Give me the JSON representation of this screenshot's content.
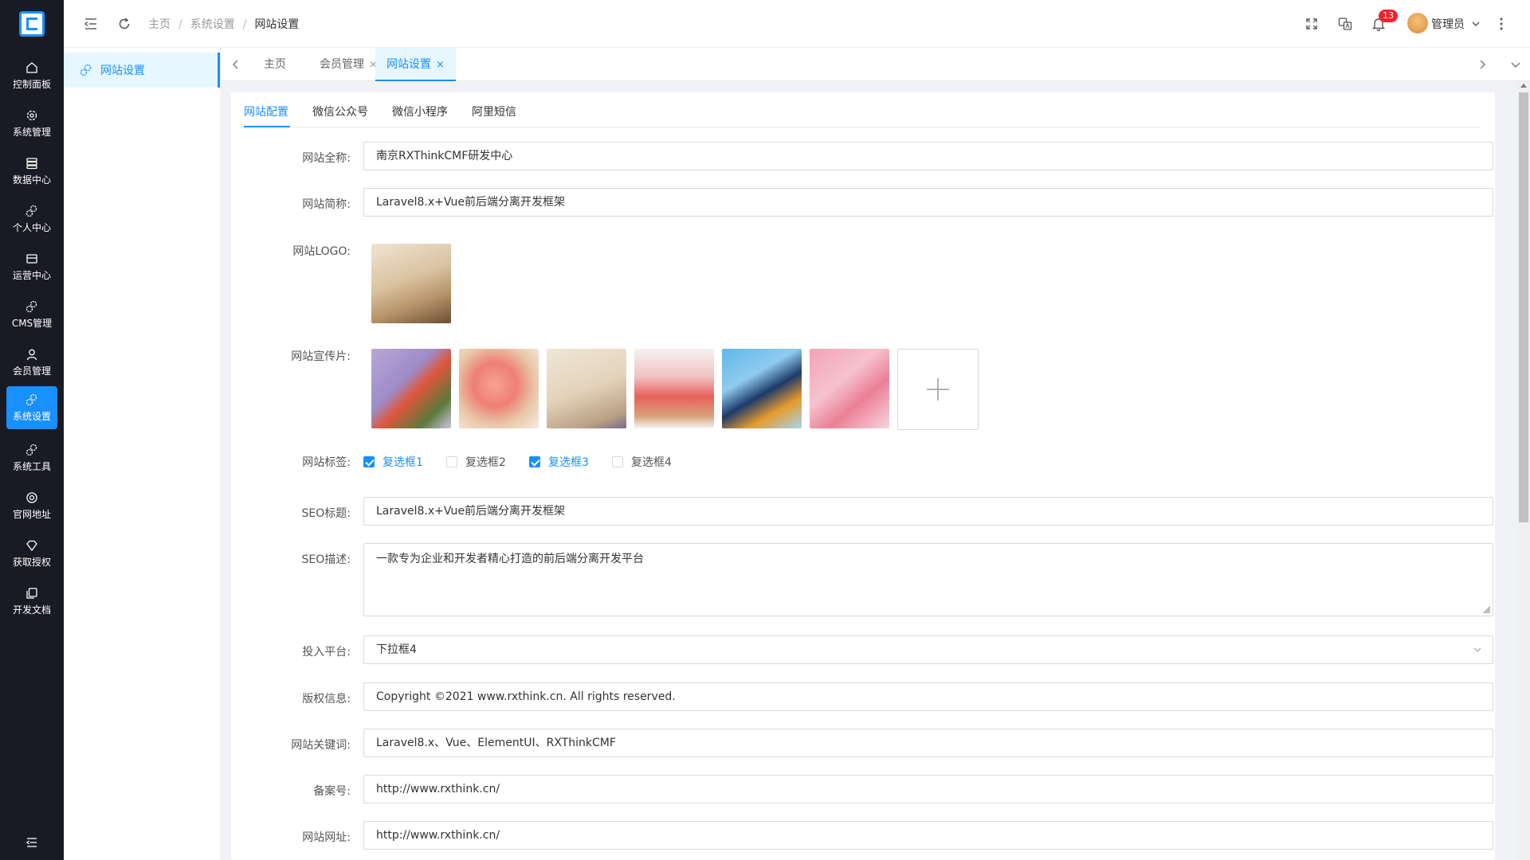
{
  "rail": {
    "items": [
      {
        "label": "控制面板",
        "icon": "home-icon"
      },
      {
        "label": "系统管理",
        "icon": "gear-icon"
      },
      {
        "label": "数据中心",
        "icon": "database-icon"
      },
      {
        "label": "个人中心",
        "icon": "gears-icon"
      },
      {
        "label": "运营中心",
        "icon": "card-icon"
      },
      {
        "label": "CMS管理",
        "icon": "gears-icon"
      },
      {
        "label": "会员管理",
        "icon": "user-icon"
      },
      {
        "label": "系统设置",
        "icon": "gears-icon",
        "active": true
      },
      {
        "label": "系统工具",
        "icon": "gears-icon"
      },
      {
        "label": "官网地址",
        "icon": "lifebuoy-icon"
      },
      {
        "label": "获取授权",
        "icon": "diamond-icon"
      },
      {
        "label": "开发文档",
        "icon": "copy-icon"
      }
    ]
  },
  "submenu": {
    "item": "网站设置"
  },
  "header": {
    "breadcrumbs": [
      "主页",
      "系统设置",
      "网站设置"
    ],
    "separator": "/",
    "notification_count": "13",
    "user_name": "管理员"
  },
  "tabs": [
    {
      "label": "主页",
      "closable": false
    },
    {
      "label": "会员管理",
      "closable": true
    },
    {
      "label": "网站设置",
      "closable": true,
      "active": true
    }
  ],
  "tab_close": "×",
  "content_tabs": [
    "网站配置",
    "微信公众号",
    "微信小程序",
    "阿里短信"
  ],
  "form": {
    "full_name": {
      "label": "网站全称:",
      "value": "南京RXThinkCMF研发中心"
    },
    "short_name": {
      "label": "网站简称:",
      "value": "Laravel8.x+Vue前后端分离开发框架"
    },
    "logo": {
      "label": "网站LOGO:"
    },
    "promo": {
      "label": "网站宣传片:"
    },
    "tags": {
      "label": "网站标签:",
      "options": [
        {
          "label": "复选框1",
          "checked": true
        },
        {
          "label": "复选框2",
          "checked": false
        },
        {
          "label": "复选框3",
          "checked": true
        },
        {
          "label": "复选框4",
          "checked": false
        }
      ]
    },
    "seo_title": {
      "label": "SEO标题:",
      "value": "Laravel8.x+Vue前后端分离开发框架"
    },
    "seo_desc": {
      "label": "SEO描述:",
      "value": "一款专为企业和开发者精心打造的前后端分离开发平台"
    },
    "platform": {
      "label": "投入平台:",
      "value": "下拉框4"
    },
    "copyright": {
      "label": "版权信息:",
      "value": "Copyright ©2021 www.rxthink.cn. All rights reserved."
    },
    "keywords": {
      "label": "网站关键词:",
      "value": "Laravel8.x、Vue、ElementUI、RXThinkCMF"
    },
    "icp": {
      "label": "备案号:",
      "value": "http://www.rxthink.cn/"
    },
    "url": {
      "label": "网站网址:",
      "value": "http://www.rxthink.cn/"
    }
  },
  "colors": {
    "accent": "#1890ff",
    "rail": "#191a23",
    "danger": "#f5222d"
  }
}
